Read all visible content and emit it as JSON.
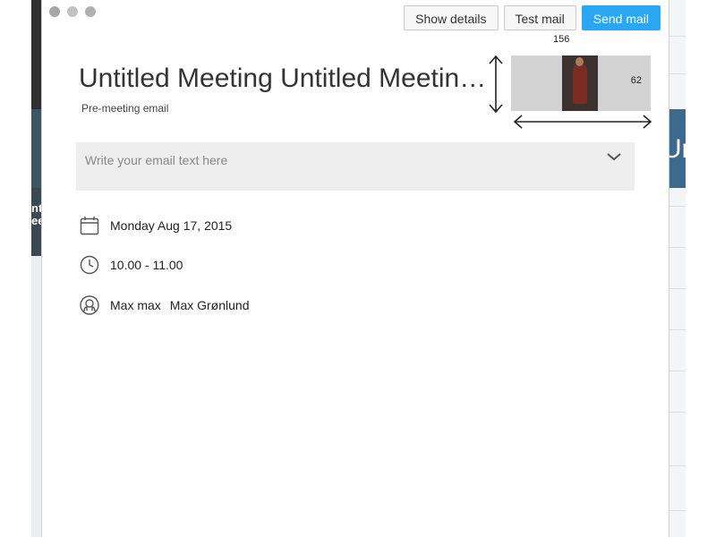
{
  "toolbar": {
    "show_details_label": "Show details",
    "test_mail_label": "Test mail",
    "send_mail_label": "Send mail"
  },
  "meeting": {
    "title": "Untitled Meeting Untitled Meeting Untitled Meeting",
    "subtitle": "Pre-meeting email"
  },
  "image": {
    "width_label": "156",
    "height_label": "62"
  },
  "email": {
    "placeholder": "Write your email text here"
  },
  "details": {
    "date": "Monday Aug 17, 2015",
    "time": "10.00 - 11.00",
    "organizer_short": "Max max",
    "organizer_full": "Max Grønlund"
  },
  "background": {
    "left_text": "nt\nee",
    "right_text": "Ur"
  },
  "colors": {
    "accent": "#2aa7f2",
    "field_bg": "#eeeeee"
  },
  "icons": [
    "calendar-icon",
    "clock-icon",
    "user-icon",
    "chevron-down-icon"
  ]
}
